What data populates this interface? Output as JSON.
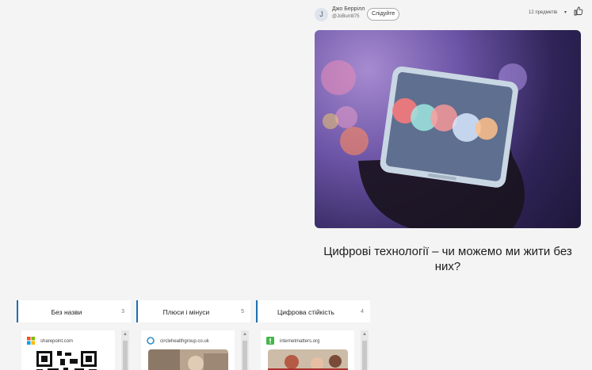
{
  "author": {
    "avatar_letter": "J",
    "name": "Джо Беррілл",
    "handle": "@JoBurrill75",
    "follow_label": "Слідуйте"
  },
  "items_count": "12 предметів",
  "caret": "▾",
  "post_title": "Цифрові технології – чи можемо ми жити без них?",
  "columns": [
    {
      "title": "Без назви",
      "count": "3",
      "source": "sharepoint.com"
    },
    {
      "title": "Плюси і мінуси",
      "count": "5",
      "source": "circlehealthgroup.co.uk"
    },
    {
      "title": "Цифрова стійкість",
      "count": "4",
      "source": "internetmatters.org"
    }
  ],
  "scroll_up": "▲",
  "colors": {
    "accent": "#1d6fb4"
  }
}
